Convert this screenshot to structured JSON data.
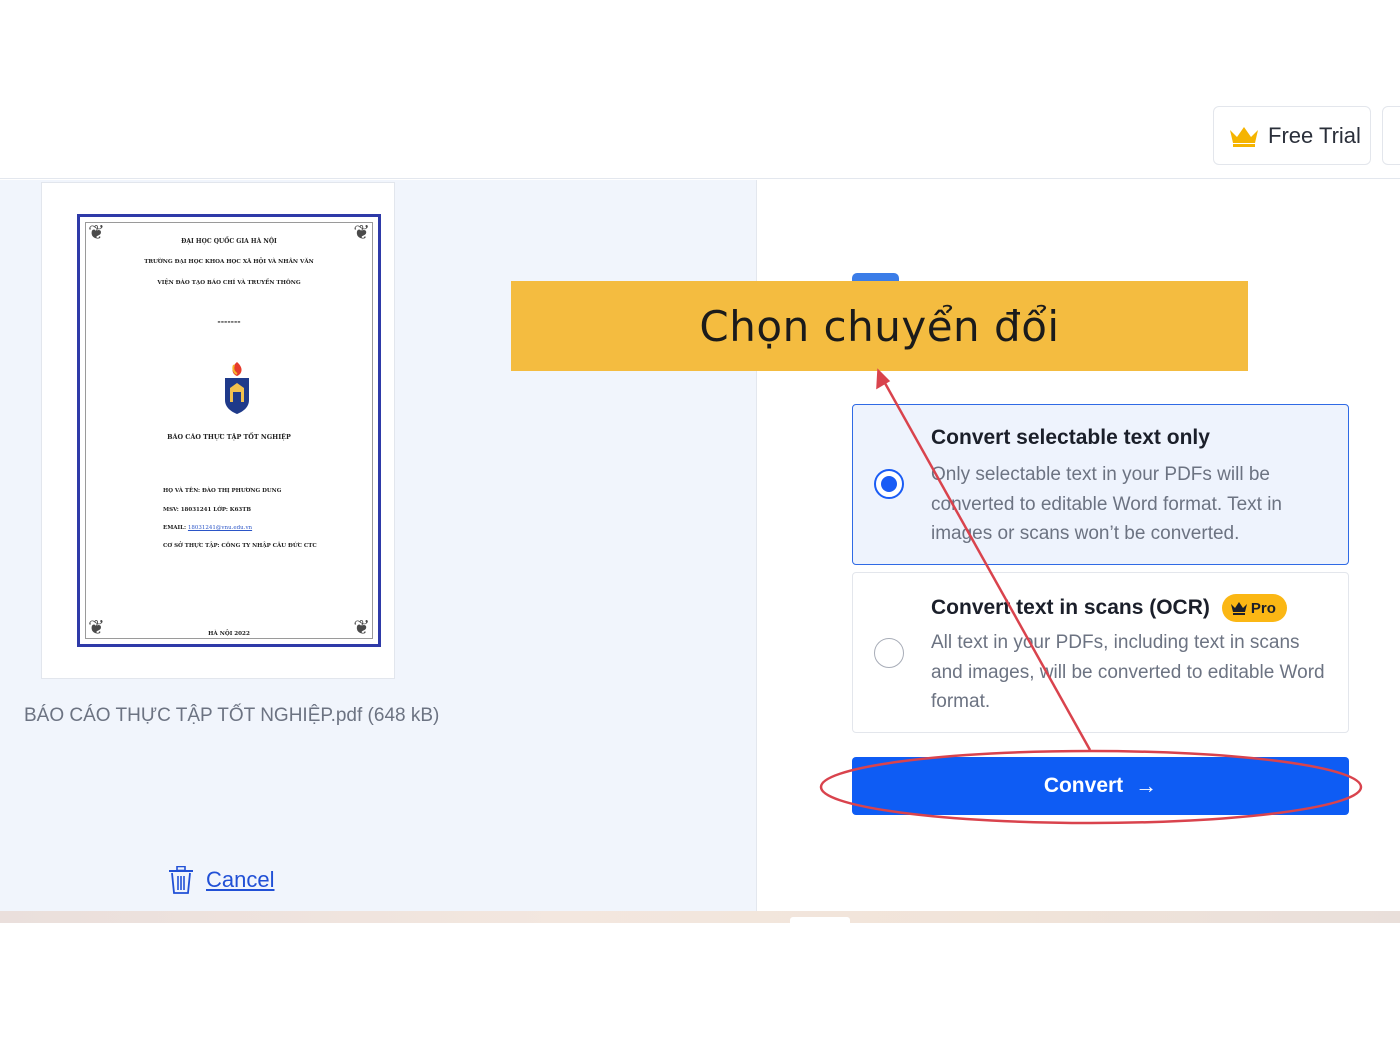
{
  "header": {
    "free_trial_label": "Free Trial"
  },
  "preview": {
    "document_lines": {
      "line1": "ĐẠI HỌC QUỐC GIA HÀ NỘI",
      "line2": "TRƯỜNG ĐẠI HỌC KHOA HỌC XÃ HỘI VÀ NHÂN VĂN",
      "line3": "VIỆN ĐÀO TẠO BÁO CHÍ VÀ TRUYỀN THÔNG",
      "divider": "-------",
      "report_title": "BÁO CÁO THỰC TẬP TỐT NGHIỆP",
      "name": "HỌ VÀ TÊN: ĐÀO THỊ PHƯƠNG DUNG",
      "msv": "MSV: 18031241   LỚP: K63TB",
      "email_label": "EMAIL: ",
      "email_value": "18031241@vnu.edu.vn",
      "place": "CƠ SỞ THỰC TẬP: CÔNG TY NHẬP CÂU ĐỨC CTC",
      "city_date": "HÀ NỘI 2022"
    },
    "file_name": "BÁO CÁO THỰC TẬP TỐT NGHIỆP.pdf (648 kB)",
    "cancel_label": "Cancel"
  },
  "options": [
    {
      "title": "Convert selectable text only",
      "description": "Only selectable text in your PDFs will be converted to editable Word format. Text in images or scans won’t be converted.",
      "selected": true
    },
    {
      "title": "Convert text in scans (OCR)",
      "badge": "Pro",
      "description": "All text in your PDFs, including text in scans and images, will be converted to editable Word format.",
      "selected": false
    }
  ],
  "convert_button": {
    "label": "Convert",
    "arrow": "→"
  },
  "annotation": {
    "callout_text": "Chọn chuyển đổi"
  },
  "colors": {
    "accent_blue": "#0e5cf4",
    "callout_yellow": "#f4bc40",
    "annotation_red": "#d9434d",
    "pro_badge": "#fbb714"
  },
  "icons": {
    "free_trial": "crown-icon",
    "pro_badge": "crown-icon",
    "cancel": "trash-icon",
    "convert": "arrow-right-icon"
  }
}
